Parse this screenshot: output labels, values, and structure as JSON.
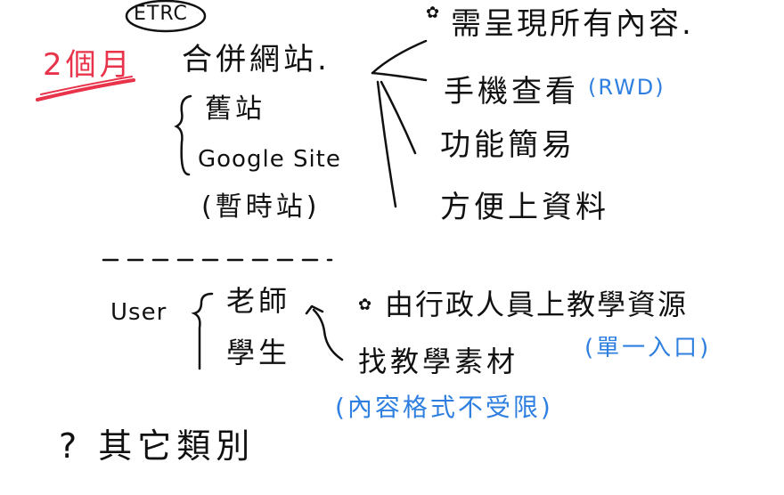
{
  "colors": {
    "ink": "#111111",
    "red": "#e8334a",
    "blue": "#2f7fe0"
  },
  "top_left": {
    "etrc": "ETRC",
    "duration": "2個月"
  },
  "section1": {
    "heading": "合併網站.",
    "sources": [
      "舊站",
      "Google Site",
      "(暫時站)"
    ],
    "requirements": {
      "star_note": "需呈現所有內容.",
      "items": [
        "手機查看",
        "功能簡易",
        "方便上資料"
      ],
      "rwd_note": "(RWD)"
    }
  },
  "divider": "— - - - - - - -",
  "section2": {
    "label": "User",
    "users": [
      "老師",
      "學生"
    ],
    "upload_note": "由行政人員上教學資源",
    "single_entry": "(單一入口)",
    "find_material": "找教學素材",
    "format_note": "(內容格式不受限)"
  },
  "bottom": {
    "question": "? 其它類別"
  }
}
